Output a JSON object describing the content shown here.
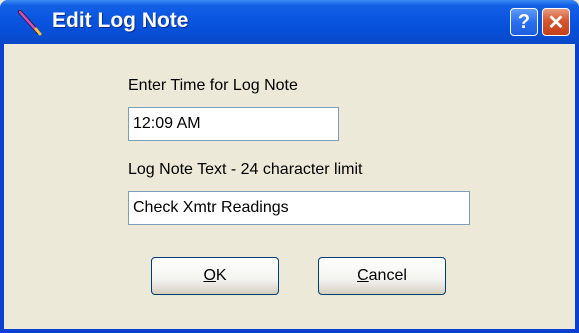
{
  "window": {
    "title": "Edit Log Note",
    "help_label": "?",
    "close_label": "✕"
  },
  "time_field": {
    "label": "Enter Time for Log Note",
    "value": "12:09 AM"
  },
  "note_field": {
    "label": "Log Note Text - 24 character limit",
    "value": "Check Xmtr Readings"
  },
  "buttons": {
    "ok": {
      "mnemonic": "O",
      "rest": "K"
    },
    "cancel": {
      "mnemonic": "C",
      "rest": "ancel"
    }
  }
}
